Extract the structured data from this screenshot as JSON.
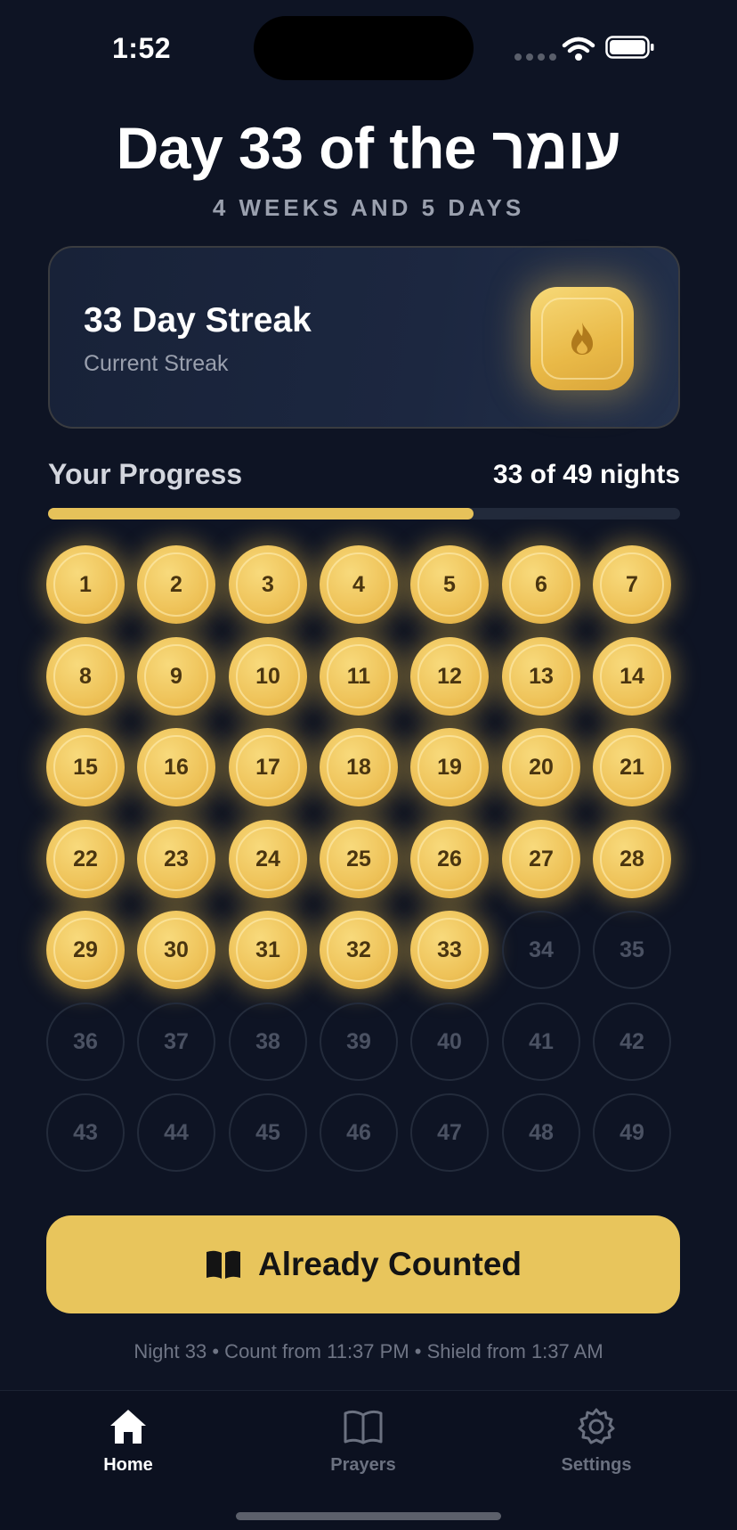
{
  "status_bar": {
    "time": "1:52"
  },
  "header": {
    "title": "Day 33 of the עומר",
    "subtitle": "4 WEEKS AND 5 DAYS"
  },
  "streak": {
    "title": "33 Day Streak",
    "subtitle": "Current Streak",
    "icon": "flame-icon"
  },
  "progress": {
    "label": "Your Progress",
    "count_text": "33 of 49 nights",
    "completed": 33,
    "total": 49,
    "fraction": 0.673
  },
  "days": {
    "labels": [
      "1",
      "2",
      "3",
      "4",
      "5",
      "6",
      "7",
      "8",
      "9",
      "10",
      "11",
      "12",
      "13",
      "14",
      "15",
      "16",
      "17",
      "18",
      "19",
      "20",
      "21",
      "22",
      "23",
      "24",
      "25",
      "26",
      "27",
      "28",
      "29",
      "30",
      "31",
      "32",
      "33",
      "34",
      "35",
      "36",
      "37",
      "38",
      "39",
      "40",
      "41",
      "42",
      "43",
      "44",
      "45",
      "46",
      "47",
      "48",
      "49"
    ],
    "completed_through": 33
  },
  "action": {
    "label": "Already Counted",
    "icon": "book-icon"
  },
  "footnote": "Night 33 • Count from 11:37 PM • Shield from 1:37 AM",
  "tabs": [
    {
      "label": "Home",
      "icon": "home-icon",
      "active": true
    },
    {
      "label": "Prayers",
      "icon": "book-open-icon",
      "active": false
    },
    {
      "label": "Settings",
      "icon": "gear-icon",
      "active": false
    }
  ],
  "colors": {
    "background": "#0e1424",
    "gold": "#e8c55c",
    "muted": "#9aa0ae"
  }
}
